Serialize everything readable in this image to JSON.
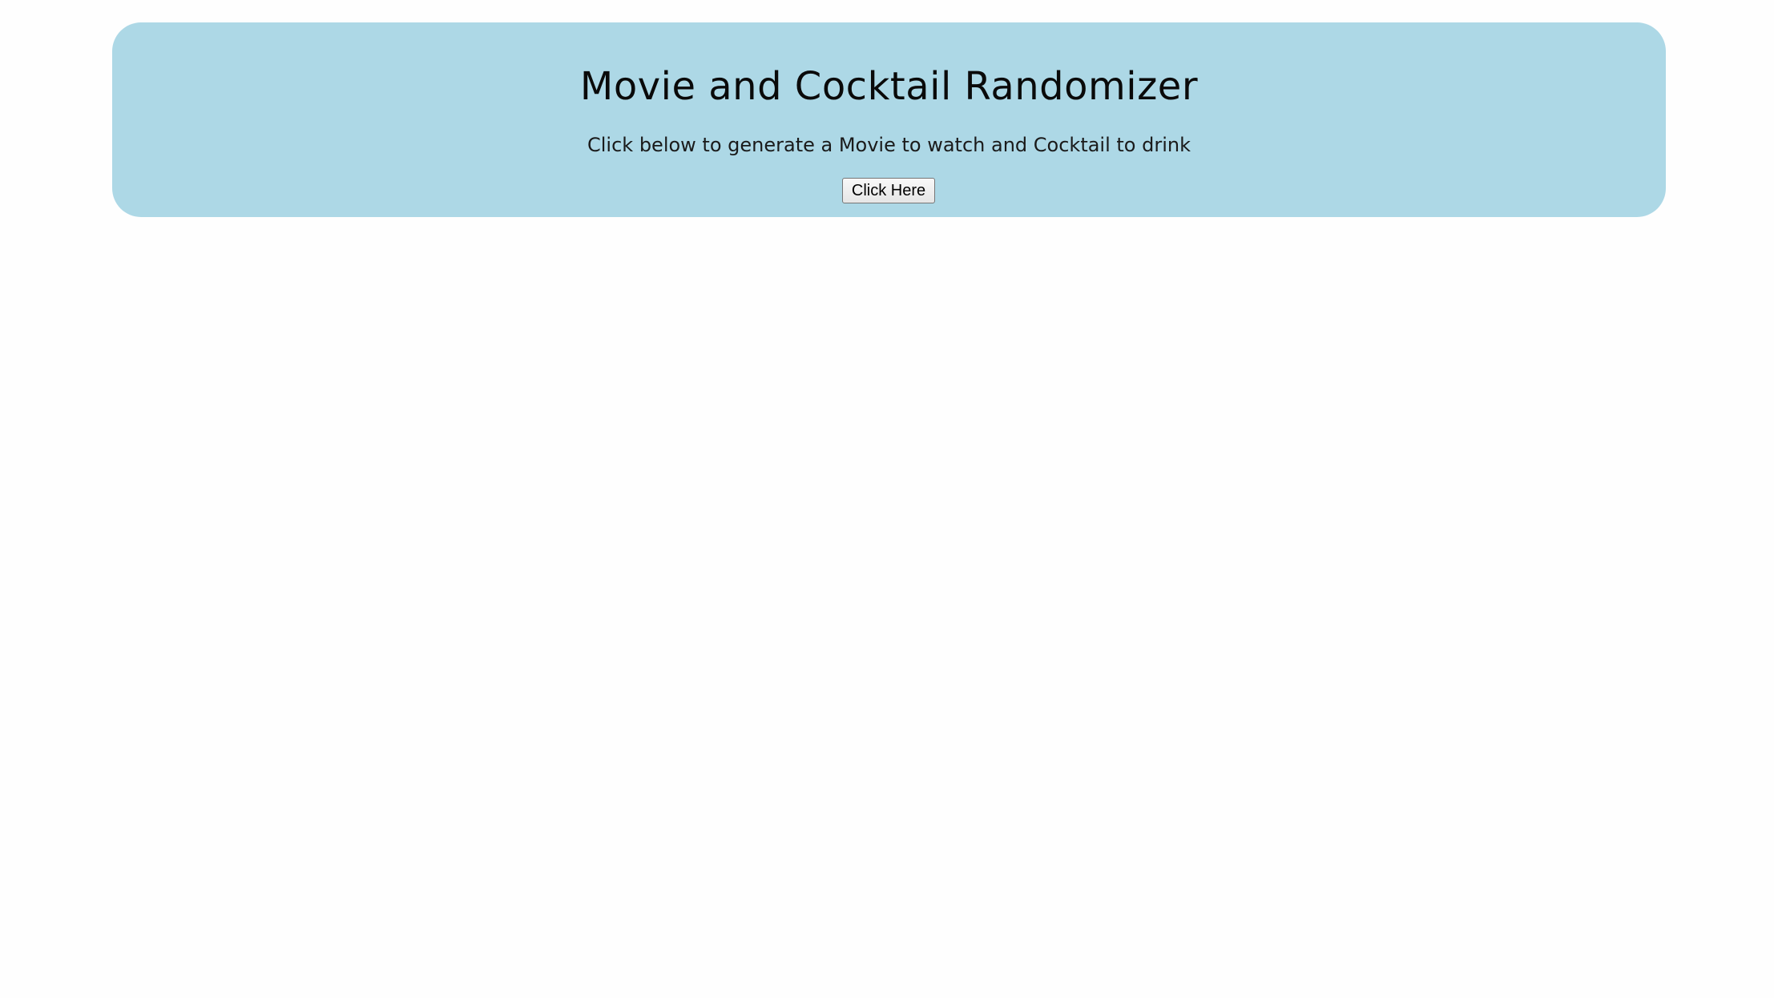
{
  "hero": {
    "title": "Movie and Cocktail Randomizer",
    "subtitle": "Click below to generate a Movie to watch and Cocktail to drink",
    "button_label": "Click Here",
    "background_color": "#add8e6"
  }
}
